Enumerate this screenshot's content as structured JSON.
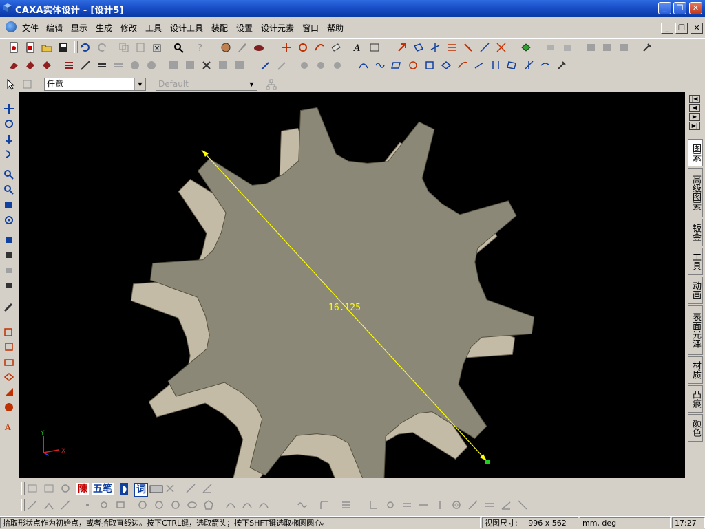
{
  "window": {
    "title": "CAXA实体设计 - [设计5]"
  },
  "menu": {
    "items": [
      "文件",
      "编辑",
      "显示",
      "生成",
      "修改",
      "工具",
      "设计工具",
      "装配",
      "设置",
      "设计元素",
      "窗口",
      "帮助"
    ]
  },
  "selectors": {
    "pick_filter": "任意",
    "style": "Default"
  },
  "viewport": {
    "measurement_value": "16.125",
    "axis_x": "X",
    "axis_y": "Y",
    "background": "#000000",
    "part_color": "#8c8878",
    "dimension_color": "#ffff00"
  },
  "right_tabs": [
    "图素",
    "高级图素",
    "钣金",
    "工具",
    "动画",
    "表面光泽",
    "材质",
    "凸痕",
    "颜色"
  ],
  "ime": {
    "lang": "陳",
    "method": "五笔",
    "mode": "词"
  },
  "status": {
    "prompt": "拾取形状点作为初始点，或者拾取直线边。按下CTRL键，选取箭头；按下SHFT键选取椭圆圆心。",
    "view_size_label": "视图尺寸:",
    "view_size": "996 x 562",
    "units": "mm, deg",
    "time": "17:27"
  }
}
